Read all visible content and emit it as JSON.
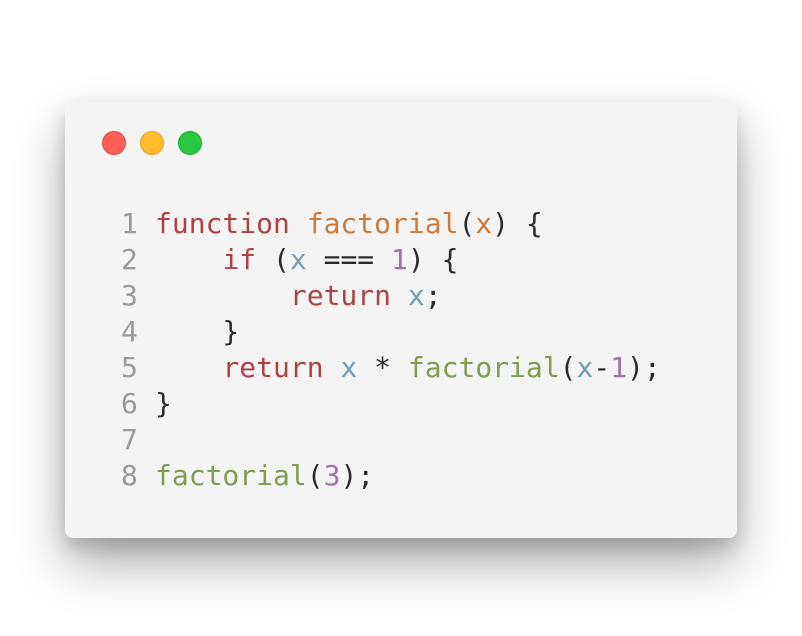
{
  "window": {
    "buttons": {
      "close_color": "#ff5f57",
      "minimize_color": "#febc2e",
      "maximize_color": "#28c840"
    }
  },
  "code": {
    "lines": [
      {
        "number": "1",
        "tokens": [
          {
            "t": "function",
            "k": "kw"
          },
          {
            "t": " ",
            "k": "op"
          },
          {
            "t": "factorial",
            "k": "fn"
          },
          {
            "t": "(",
            "k": "op"
          },
          {
            "t": "x",
            "k": "fn"
          },
          {
            "t": ") {",
            "k": "op"
          }
        ]
      },
      {
        "number": "2",
        "tokens": [
          {
            "t": "    ",
            "k": "op"
          },
          {
            "t": "if",
            "k": "kw"
          },
          {
            "t": " (",
            "k": "op"
          },
          {
            "t": "x",
            "k": "var"
          },
          {
            "t": " === ",
            "k": "op"
          },
          {
            "t": "1",
            "k": "num"
          },
          {
            "t": ") {",
            "k": "op"
          }
        ]
      },
      {
        "number": "3",
        "tokens": [
          {
            "t": "        ",
            "k": "op"
          },
          {
            "t": "return",
            "k": "kw"
          },
          {
            "t": " ",
            "k": "op"
          },
          {
            "t": "x",
            "k": "var"
          },
          {
            "t": ";",
            "k": "op"
          }
        ]
      },
      {
        "number": "4",
        "tokens": [
          {
            "t": "    }",
            "k": "op"
          }
        ]
      },
      {
        "number": "5",
        "tokens": [
          {
            "t": "    ",
            "k": "op"
          },
          {
            "t": "return",
            "k": "kw"
          },
          {
            "t": " ",
            "k": "op"
          },
          {
            "t": "x",
            "k": "var"
          },
          {
            "t": " * ",
            "k": "op"
          },
          {
            "t": "factorial",
            "k": "call"
          },
          {
            "t": "(",
            "k": "op"
          },
          {
            "t": "x",
            "k": "var"
          },
          {
            "t": "-",
            "k": "op"
          },
          {
            "t": "1",
            "k": "num"
          },
          {
            "t": ");",
            "k": "op"
          }
        ]
      },
      {
        "number": "6",
        "tokens": [
          {
            "t": "}",
            "k": "op"
          }
        ]
      },
      {
        "number": "7",
        "tokens": []
      },
      {
        "number": "8",
        "tokens": [
          {
            "t": "factorial",
            "k": "call"
          },
          {
            "t": "(",
            "k": "op"
          },
          {
            "t": "3",
            "k": "num"
          },
          {
            "t": ");",
            "k": "op"
          }
        ]
      }
    ]
  }
}
